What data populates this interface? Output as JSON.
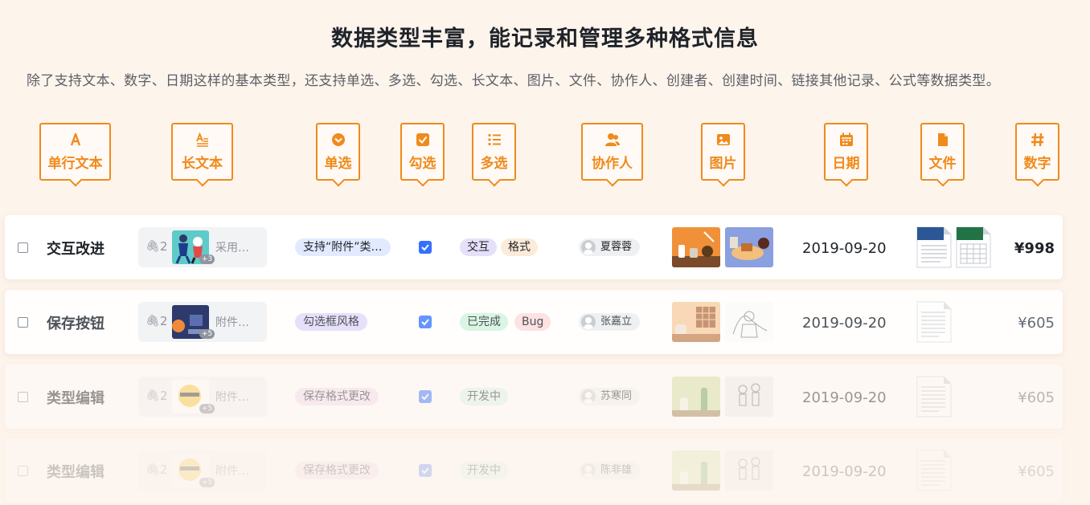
{
  "title": "数据类型丰富，能记录和管理多种格式信息",
  "subtitle": "除了支持文本、数字、日期这样的基本类型，还支持单选、多选、勾选、长文本、图片、文件、协作人、创建者、创建时间、链接其他记录、公式等数据类型。",
  "field_types": [
    {
      "label": "单行文本",
      "icon": "text-icon"
    },
    {
      "label": "长文本",
      "icon": "long-text-icon"
    },
    {
      "label": "单选",
      "icon": "single-select-icon"
    },
    {
      "label": "勾选",
      "icon": "checkbox-icon"
    },
    {
      "label": "多选",
      "icon": "multi-select-icon"
    },
    {
      "label": "协作人",
      "icon": "people-icon"
    },
    {
      "label": "图片",
      "icon": "image-icon"
    },
    {
      "label": "日期",
      "icon": "calendar-icon"
    },
    {
      "label": "文件",
      "icon": "file-icon"
    },
    {
      "label": "数字",
      "icon": "hash-icon"
    }
  ],
  "rows": [
    {
      "name": "交互改进",
      "attach_count": "2",
      "attach_more": "+3",
      "attach_text": "采用…",
      "single": "支持“附件”类…",
      "single_color": "#e1eaff",
      "multi": [
        {
          "label": "交互",
          "color": "#e6e0fa"
        },
        {
          "label": "格式",
          "color": "#fdebd9"
        }
      ],
      "person": "夏蓉蓉",
      "date": "2019-09-20",
      "number": "¥998",
      "checked": true
    },
    {
      "name": "保存按钮",
      "attach_count": "2",
      "attach_more": "+5",
      "attach_text": "附件…",
      "single": "勾选框风格",
      "single_color": "#e6e0fa",
      "multi": [
        {
          "label": "已完成",
          "color": "#d9f5e3"
        },
        {
          "label": "Bug",
          "color": "#fde2e2"
        }
      ],
      "person": "张嘉立",
      "date": "2019-09-20",
      "number": "¥605",
      "checked": true
    },
    {
      "name": "类型编辑",
      "attach_count": "2",
      "attach_more": "+5",
      "attach_text": "附件…",
      "single": "保存格式更改",
      "single_color": "#f3dcf3",
      "multi": [
        {
          "label": "开发中",
          "color": "#d9f5ee"
        }
      ],
      "person": "苏寒同",
      "date": "2019-09-20",
      "number": "¥605",
      "checked": true
    },
    {
      "name": "类型编辑",
      "attach_count": "2",
      "attach_more": "+5",
      "attach_text": "附件…",
      "single": "保存格式更改",
      "single_color": "#f3dcf3",
      "multi": [
        {
          "label": "开发中",
          "color": "#d9f5ee"
        }
      ],
      "person": "陈非雄",
      "date": "2019-09-20",
      "number": "¥605",
      "checked": true
    }
  ],
  "colors": {
    "accent": "#f08a1c",
    "checkbox": "#3370ff",
    "background": "#fdf4ec"
  }
}
